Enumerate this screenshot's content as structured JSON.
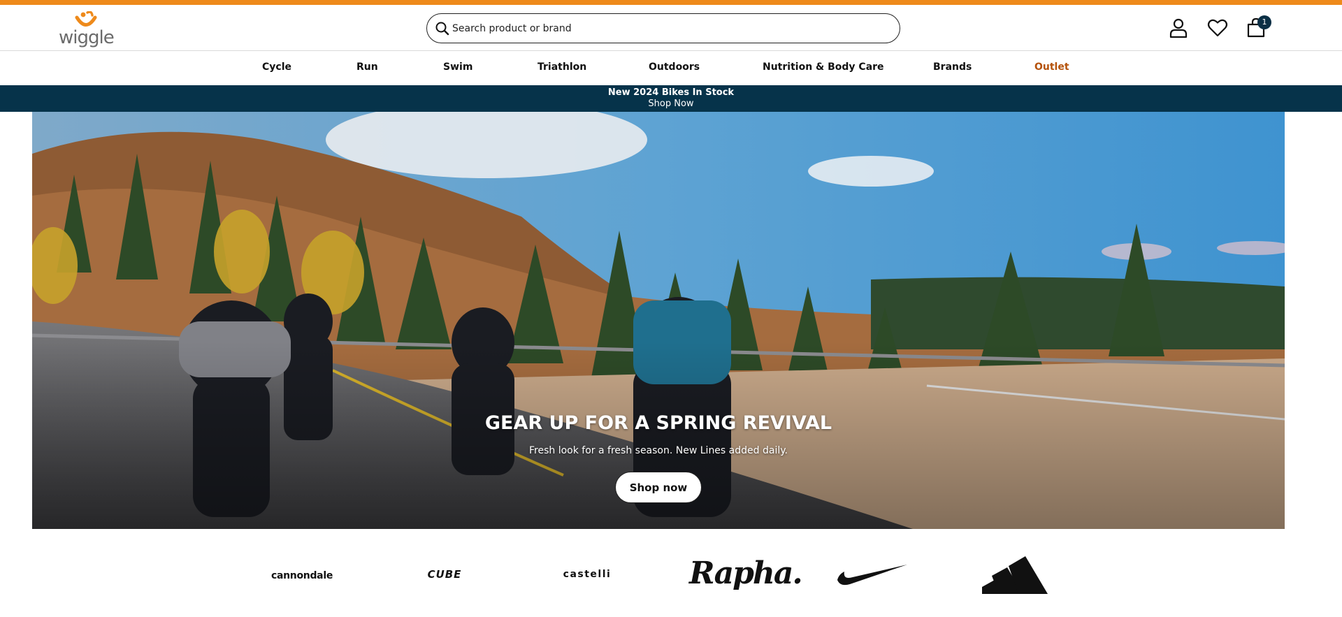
{
  "colors": {
    "top_accent": "#ee8a1b",
    "promo_background": "#06334a",
    "outlet_link": "#b5520a",
    "cart_badge": "#0b2f45"
  },
  "logo": {
    "text": "wiggle",
    "icon": "wiggle-logo-icon"
  },
  "search": {
    "placeholder": "Search product or brand",
    "icon": "search-icon"
  },
  "header_actions": {
    "account_icon": "account-icon",
    "wishlist_icon": "heart-icon",
    "cart_icon": "bag-icon",
    "cart_count": "1"
  },
  "nav": {
    "items": [
      {
        "label": "Cycle"
      },
      {
        "label": "Run"
      },
      {
        "label": "Swim"
      },
      {
        "label": "Triathlon"
      },
      {
        "label": "Outdoors"
      },
      {
        "label": "Nutrition & Body Care"
      },
      {
        "label": "Brands"
      },
      {
        "label": "Outlet"
      }
    ]
  },
  "promo": {
    "title": "New 2024 Bikes In Stock",
    "link": "Shop Now"
  },
  "hero": {
    "title": "GEAR UP FOR A SPRING REVIVAL",
    "subtitle": "Fresh look for a fresh season. New Lines added daily.",
    "button": "Shop now"
  },
  "brands": {
    "items": [
      {
        "label": "cannondale"
      },
      {
        "label": "CUBE"
      },
      {
        "label": "castelli"
      },
      {
        "label": "Rapha."
      },
      {
        "label": "Nike",
        "icon": "nike-swoosh-logo"
      },
      {
        "label": "adidas",
        "icon": "adidas-logo"
      }
    ]
  }
}
